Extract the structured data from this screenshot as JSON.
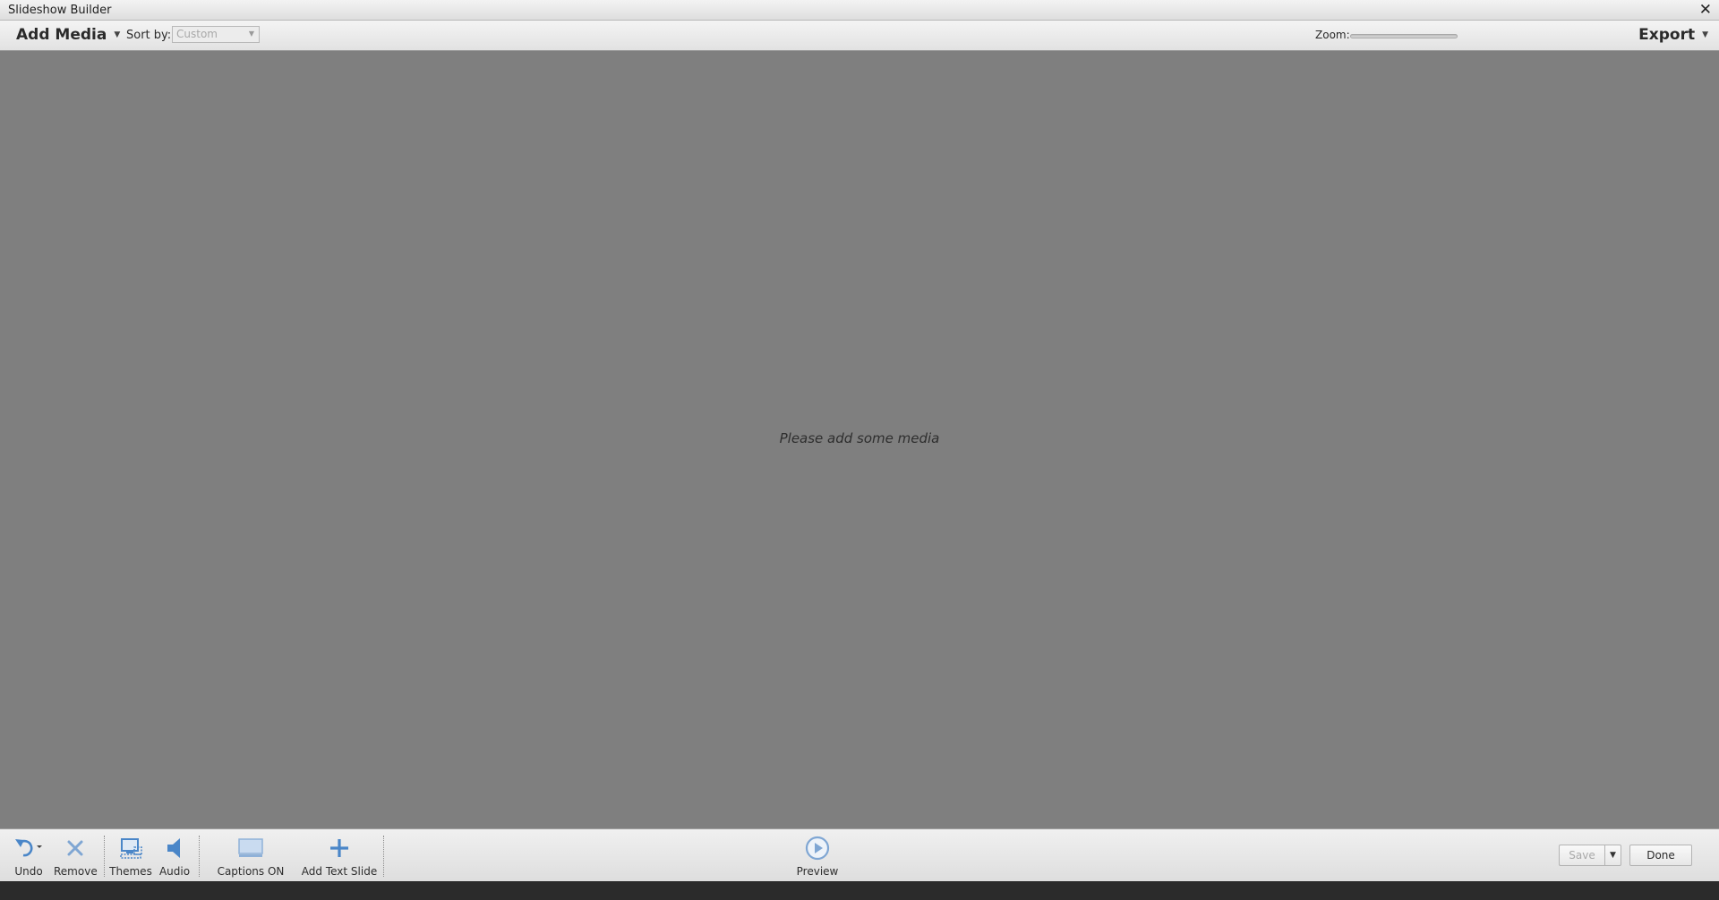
{
  "window": {
    "title": "Slideshow Builder",
    "close_glyph": "✕"
  },
  "topbar": {
    "add_media_label": "Add Media",
    "sort_label": "Sort by:",
    "sort_value": "Custom",
    "zoom_label": "Zoom:",
    "export_label": "Export"
  },
  "canvas": {
    "empty_message": "Please add some media"
  },
  "toolbar": {
    "undo_label": "Undo",
    "remove_label": "Remove",
    "themes_label": "Themes",
    "audio_label": "Audio",
    "captions_label": "Captions ON",
    "add_text_slide_label": "Add Text Slide",
    "preview_label": "Preview",
    "save_label": "Save",
    "done_label": "Done"
  },
  "icons": [
    "undo-icon",
    "remove-icon",
    "themes-icon",
    "audio-icon",
    "captions-icon",
    "add-text-slide-icon",
    "preview-icon"
  ],
  "colors": {
    "icon_blue": "#4a86c8",
    "canvas": "#7f7f7f",
    "disabled_text": "#a9a9a9"
  }
}
